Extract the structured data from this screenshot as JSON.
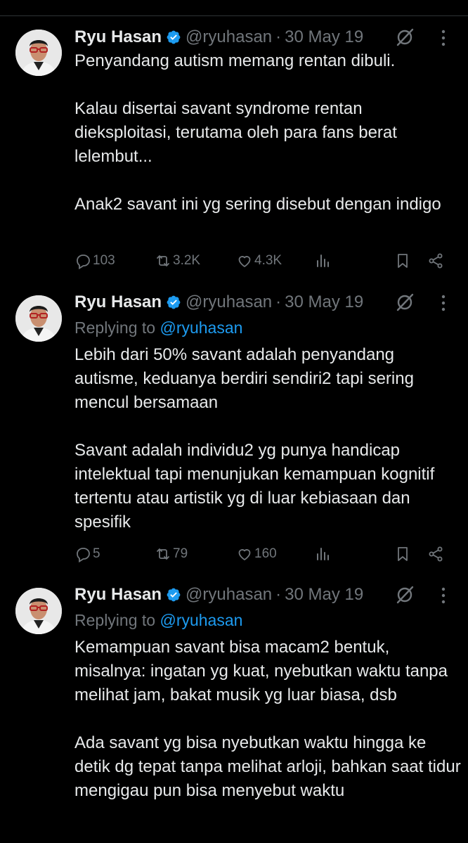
{
  "colors": {
    "background": "#000000",
    "text": "#e7e9ea",
    "muted": "#71767b",
    "accent": "#1d9bf0"
  },
  "tweets": [
    {
      "name": "Ryu Hasan",
      "handle": "@ryuhasan",
      "separator": "·",
      "date": "30 May 19",
      "replying_prefix": "",
      "replying_to": "",
      "text": "Penyandang autism memang rentan dibuli.\n\nKalau disertai savant syndrome  rentan dieksploitasi, terutama oleh para fans berat lelembut...\n\nAnak2 savant ini yg sering disebut dengan indigo",
      "replies": "103",
      "reposts": "3.2K",
      "likes": "4.3K"
    },
    {
      "name": "Ryu Hasan",
      "handle": "@ryuhasan",
      "separator": "·",
      "date": "30 May 19",
      "replying_prefix": "Replying to ",
      "replying_to": "@ryuhasan",
      "text": "Lebih dari 50% savant adalah penyandang autisme, keduanya berdiri sendiri2 tapi sering mencul bersamaan\n\nSavant adalah individu2 yg punya handicap intelektual tapi menunjukan kemampuan kognitif tertentu atau artistik yg di luar kebiasaan dan spesifik",
      "replies": "5",
      "reposts": "79",
      "likes": "160"
    },
    {
      "name": "Ryu Hasan",
      "handle": "@ryuhasan",
      "separator": "·",
      "date": "30 May 19",
      "replying_prefix": "Replying to ",
      "replying_to": "@ryuhasan",
      "text": "Kemampuan savant bisa macam2 bentuk, misalnya: ingatan yg kuat, nyebutkan waktu tanpa melihat jam, bakat musik yg luar biasa, dsb\n\nAda savant yg bisa nyebutkan waktu hingga ke detik dg tepat tanpa melihat arloji, bahkan saat tidur mengigau pun bisa menyebut waktu"
    }
  ],
  "icons": {
    "verified": "verified-badge-icon",
    "grok": "grok-icon",
    "more": "more-options-icon",
    "reply": "reply-icon",
    "repost": "repost-icon",
    "like": "like-icon",
    "views": "views-icon",
    "bookmark": "bookmark-icon",
    "share": "share-icon"
  }
}
